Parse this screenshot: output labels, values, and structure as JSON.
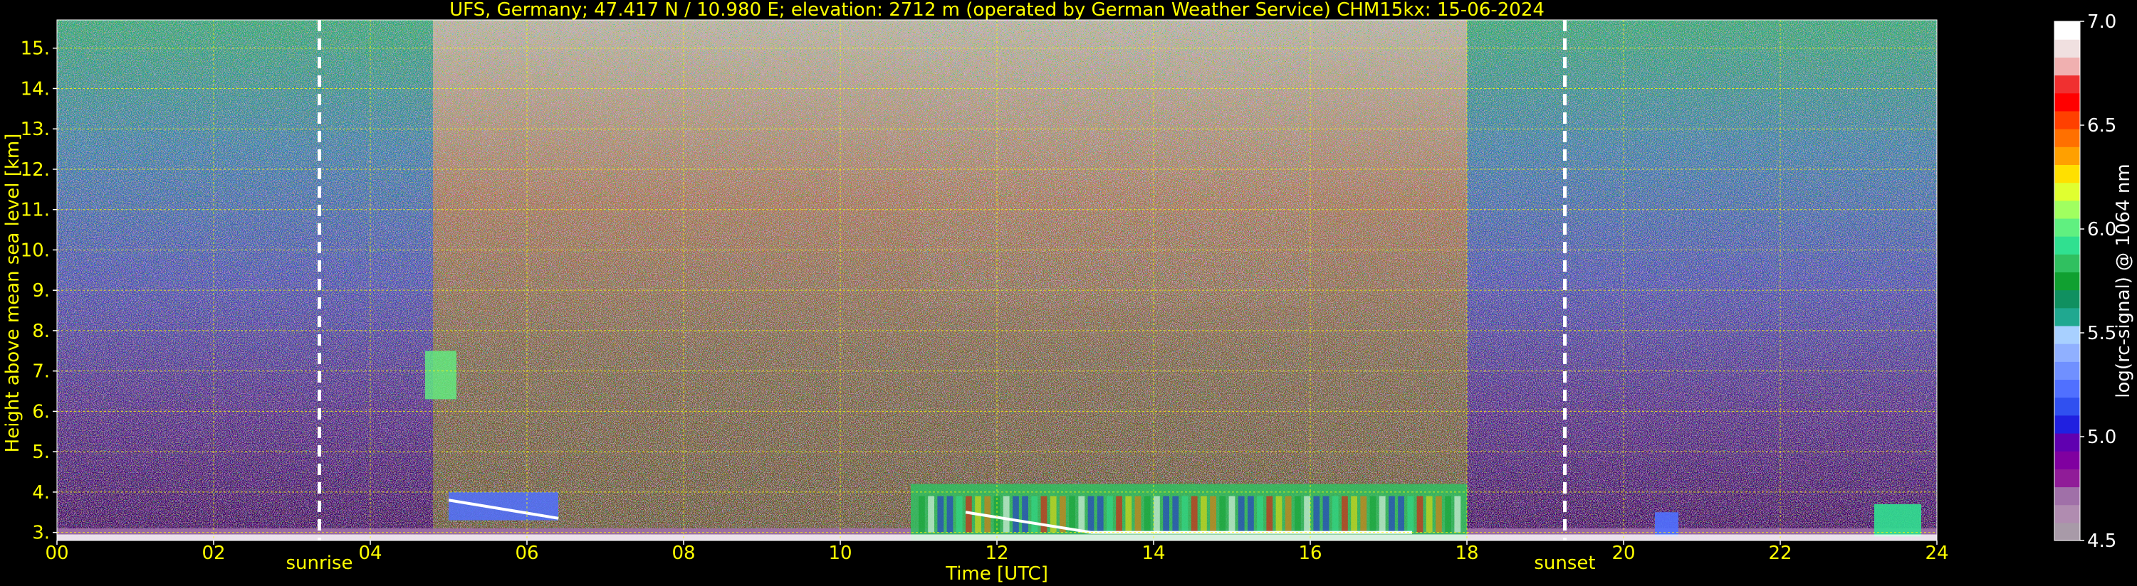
{
  "chart_data": {
    "type": "heatmap",
    "title": "UFS, Germany; 47.417 N / 10.980 E; elevation: 2712 m  (operated by German Weather Service)    CHM15kx: 15-06-2024",
    "xlabel": "Time [UTC]",
    "ylabel": "Height above mean sea level [km]",
    "xlim": [
      0,
      24
    ],
    "ylim": [
      2.8,
      15.7
    ],
    "x_ticks": [
      "00",
      "02",
      "04",
      "06",
      "08",
      "10",
      "12",
      "14",
      "16",
      "18",
      "20",
      "22",
      "24"
    ],
    "x_tick_values": [
      0,
      2,
      4,
      6,
      8,
      10,
      12,
      14,
      16,
      18,
      20,
      22,
      24
    ],
    "y_ticks": [
      "3.",
      "4.",
      "5.",
      "6.",
      "7.",
      "8.",
      "9.",
      "10.",
      "11.",
      "12.",
      "13.",
      "14.",
      "15."
    ],
    "y_tick_values": [
      3,
      4,
      5,
      6,
      7,
      8,
      9,
      10,
      11,
      12,
      13,
      14,
      15
    ],
    "grid": true,
    "colorbar": {
      "label": "log(rc-signal) @ 1064 nm",
      "range": [
        4.5,
        7.0
      ],
      "ticks": [
        "4.5",
        "5.0",
        "5.5",
        "6.0",
        "6.5",
        "7.0"
      ],
      "tick_values": [
        4.5,
        5.0,
        5.5,
        6.0,
        6.5,
        7.0
      ],
      "colors": [
        "#a89aa8",
        "#b08cb0",
        "#a070a8",
        "#901c98",
        "#8000a0",
        "#6000b0",
        "#2020e0",
        "#3050f0",
        "#5070ff",
        "#7090ff",
        "#90b0ff",
        "#a8d0ff",
        "#20a890",
        "#109060",
        "#10a030",
        "#30c060",
        "#30e090",
        "#60f080",
        "#a0ff60",
        "#e0ff30",
        "#ffe000",
        "#ffa000",
        "#ff7000",
        "#ff4000",
        "#ff0000",
        "#f03030",
        "#f0b0b0",
        "#f0e0e0",
        "#ffffff"
      ]
    },
    "annotations": [
      {
        "label": "sunrise",
        "x": 3.35
      },
      {
        "label": "sunset",
        "x": 19.25
      }
    ],
    "features": [
      {
        "name": "low boundary layer signal",
        "x_range": [
          0,
          24
        ],
        "y_range": [
          2.8,
          3.1
        ]
      },
      {
        "name": "cloud layer morning",
        "x_range": [
          5.0,
          6.4
        ],
        "y_range": [
          3.3,
          4.0
        ]
      },
      {
        "name": "aerosol streak",
        "x_range": [
          4.7,
          5.1
        ],
        "y_range": [
          6.3,
          7.5
        ]
      },
      {
        "name": "cloud layer midday",
        "x_range": [
          10.9,
          18.0
        ],
        "y_range": [
          2.8,
          4.2
        ]
      },
      {
        "name": "high noise background daytime",
        "x_range": [
          4.8,
          18.0
        ],
        "y_range": [
          4.0,
          15.7
        ]
      },
      {
        "name": "evening small clouds",
        "x_range": [
          20.4,
          20.7
        ],
        "y_range": [
          2.9,
          3.5
        ]
      },
      {
        "name": "late evening cloud",
        "x_range": [
          23.2,
          23.8
        ],
        "y_range": [
          2.9,
          3.7
        ]
      }
    ]
  }
}
